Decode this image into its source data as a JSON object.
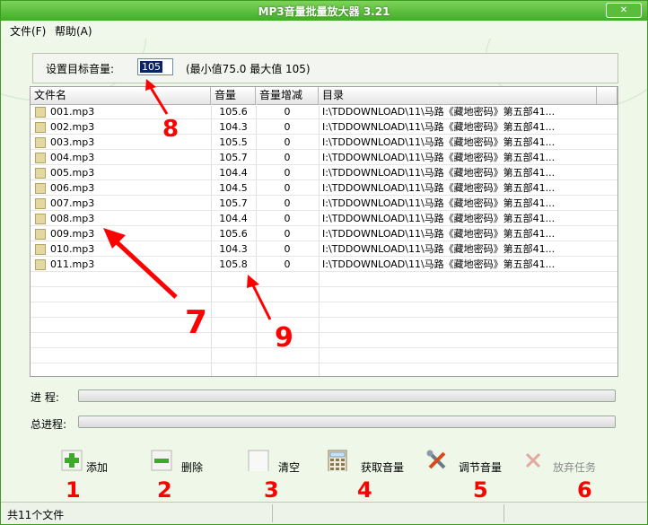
{
  "app": {
    "title": "MP3音量批量放大器  3.21"
  },
  "menu": [
    "文件(F)",
    "帮助(A)"
  ],
  "target": {
    "label": "设置目标音量:",
    "value": "105",
    "hint": "(最小值75.0  最大值 105)"
  },
  "table": {
    "columns": [
      "文件名",
      "音量",
      "音量增减",
      "目录"
    ],
    "rows": [
      {
        "name": "001.mp3",
        "volume": "105.6",
        "delta": "0",
        "dir": "I:\\TDDOWNLOAD\\11\\马路《藏地密码》第五部41..."
      },
      {
        "name": "002.mp3",
        "volume": "104.3",
        "delta": "0",
        "dir": "I:\\TDDOWNLOAD\\11\\马路《藏地密码》第五部41..."
      },
      {
        "name": "003.mp3",
        "volume": "105.5",
        "delta": "0",
        "dir": "I:\\TDDOWNLOAD\\11\\马路《藏地密码》第五部41..."
      },
      {
        "name": "004.mp3",
        "volume": "105.7",
        "delta": "0",
        "dir": "I:\\TDDOWNLOAD\\11\\马路《藏地密码》第五部41..."
      },
      {
        "name": "005.mp3",
        "volume": "104.4",
        "delta": "0",
        "dir": "I:\\TDDOWNLOAD\\11\\马路《藏地密码》第五部41..."
      },
      {
        "name": "006.mp3",
        "volume": "104.5",
        "delta": "0",
        "dir": "I:\\TDDOWNLOAD\\11\\马路《藏地密码》第五部41..."
      },
      {
        "name": "007.mp3",
        "volume": "105.7",
        "delta": "0",
        "dir": "I:\\TDDOWNLOAD\\11\\马路《藏地密码》第五部41..."
      },
      {
        "name": "008.mp3",
        "volume": "104.4",
        "delta": "0",
        "dir": "I:\\TDDOWNLOAD\\11\\马路《藏地密码》第五部41..."
      },
      {
        "name": "009.mp3",
        "volume": "105.6",
        "delta": "0",
        "dir": "I:\\TDDOWNLOAD\\11\\马路《藏地密码》第五部41..."
      },
      {
        "name": "010.mp3",
        "volume": "104.3",
        "delta": "0",
        "dir": "I:\\TDDOWNLOAD\\11\\马路《藏地密码》第五部41..."
      },
      {
        "name": "011.mp3",
        "volume": "105.8",
        "delta": "0",
        "dir": "I:\\TDDOWNLOAD\\11\\马路《藏地密码》第五部41..."
      }
    ]
  },
  "progress": {
    "label": "进  程:",
    "value": 0
  },
  "total_progress": {
    "label": "总进程:",
    "value": 0
  },
  "toolbar": {
    "add": "添加",
    "delete": "删除",
    "clear": "清空",
    "get_volume": "获取音量",
    "adjust_volume": "调节音量",
    "abandon": "放弃任务"
  },
  "status": {
    "text": "共11个文件"
  },
  "annotations": [
    "1",
    "2",
    "3",
    "4",
    "5",
    "6",
    "7",
    "8",
    "9"
  ],
  "colors": {
    "accent": "#3fae26",
    "annotation": "#ff0000"
  },
  "icons": {
    "add": "plus-icon",
    "delete": "minus-icon",
    "clear": "blank-page-icon",
    "get_volume": "calculator-icon",
    "adjust_volume": "tools-icon",
    "abandon": "x-icon"
  }
}
